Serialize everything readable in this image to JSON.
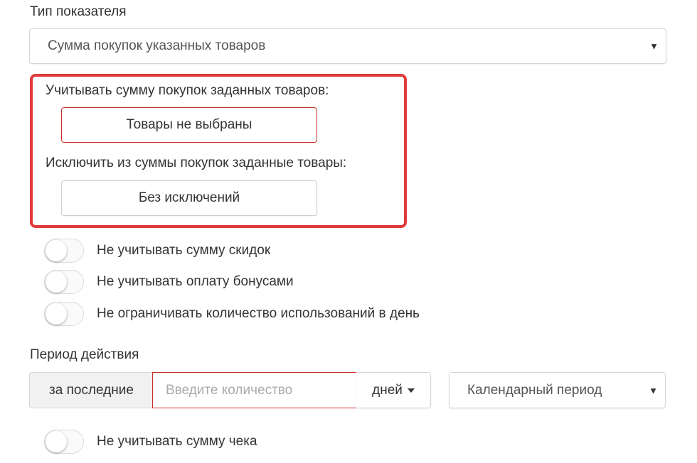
{
  "indicator": {
    "label": "Тип показателя",
    "selected": "Сумма покупок указанных товаров",
    "arrow": "▼"
  },
  "goods_box": {
    "include_label": "Учитывать сумму покупок заданных товаров:",
    "include_button": "Товары не выбраны",
    "exclude_label": "Исключить из суммы покупок заданные товары:",
    "exclude_button": "Без исключений",
    "highlight_color": "#e03a3a"
  },
  "toggles": {
    "no_discounts": "Не учитывать сумму скидок",
    "no_bonus_payment": "Не учитывать оплату бонусами",
    "no_daily_limit": "Не ограничивать количество использований в день",
    "no_check_sum": "Не учитывать сумму чека"
  },
  "period": {
    "label": "Период действия",
    "prefix": "за последние",
    "quantity_placeholder": "Введите количество",
    "quantity_value": "",
    "unit": "дней",
    "calendar_selected": "Календарный период",
    "arrow": "▼"
  },
  "colors": {
    "error_border": "#c9302c",
    "text": "#333333"
  }
}
